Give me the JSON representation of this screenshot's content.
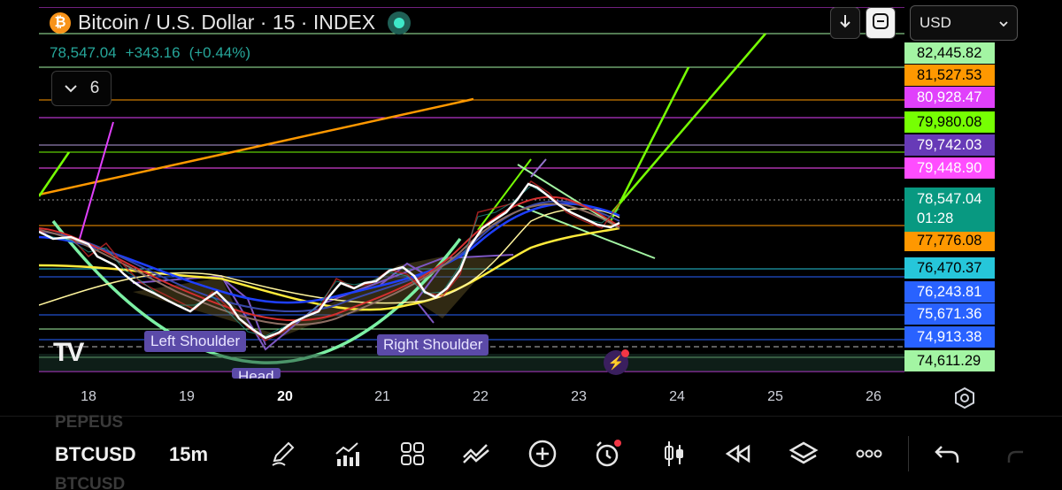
{
  "header": {
    "title": "Bitcoin / U.S. Dollar · 15 · INDEX",
    "coin_glyph": "₿",
    "last_price": "78,547.04",
    "change": "+343.16",
    "change_pct": "(+0.44%)",
    "indicator_count": "6"
  },
  "currency": {
    "selected": "USD"
  },
  "price_axis": {
    "levels": [
      {
        "label": "82,445.82",
        "bg": "#a3f5a3",
        "fg": "#000000"
      },
      {
        "label": "81,527.53",
        "bg": "#ff9800",
        "fg": "#000000"
      },
      {
        "label": "80,928.47",
        "bg": "#e040fb",
        "fg": "#ffffff"
      },
      {
        "label": "79,980.08",
        "bg": "#76ff03",
        "fg": "#000000"
      },
      {
        "label": "79,742.03",
        "bg": "#673ab7",
        "fg": "#ffffff"
      },
      {
        "label": "79,448.90",
        "bg": "#ff4dff",
        "fg": "#ffffff"
      },
      {
        "label": "77,776.08",
        "bg": "#ff9800",
        "fg": "#000000"
      },
      {
        "label": "76,470.37",
        "bg": "#26c6da",
        "fg": "#000000"
      },
      {
        "label": "76,243.81",
        "bg": "#2962ff",
        "fg": "#ffffff"
      },
      {
        "label": "75,671.36",
        "bg": "#2962ff",
        "fg": "#ffffff"
      },
      {
        "label": "74,913.38",
        "bg": "#2962ff",
        "fg": "#ffffff"
      },
      {
        "label": "74,611.29",
        "bg": "#a3f5a3",
        "fg": "#000000"
      }
    ],
    "current": {
      "price": "78,547.04",
      "countdown": "01:28",
      "color": "#089981"
    }
  },
  "time_axis": {
    "ticks": [
      {
        "label": "18",
        "bold": false
      },
      {
        "label": "19",
        "bold": false
      },
      {
        "label": "20",
        "bold": true
      },
      {
        "label": "21",
        "bold": false
      },
      {
        "label": "22",
        "bold": false
      },
      {
        "label": "23",
        "bold": false
      },
      {
        "label": "24",
        "bold": false
      },
      {
        "label": "25",
        "bold": false
      },
      {
        "label": "26",
        "bold": false
      }
    ]
  },
  "annotations": {
    "left_shoulder": "Left Shoulder",
    "head": "Head",
    "right_shoulder": "Right Shoulder"
  },
  "watermark": "TV",
  "toolbar": {
    "symbol": "BTCUSD",
    "interval": "15m",
    "ghost_above": "PEPEUS",
    "ghost_below": "BTCUSD"
  },
  "colors": {
    "positive": "#26a69a",
    "pattern_label": "#5b4aa8"
  }
}
